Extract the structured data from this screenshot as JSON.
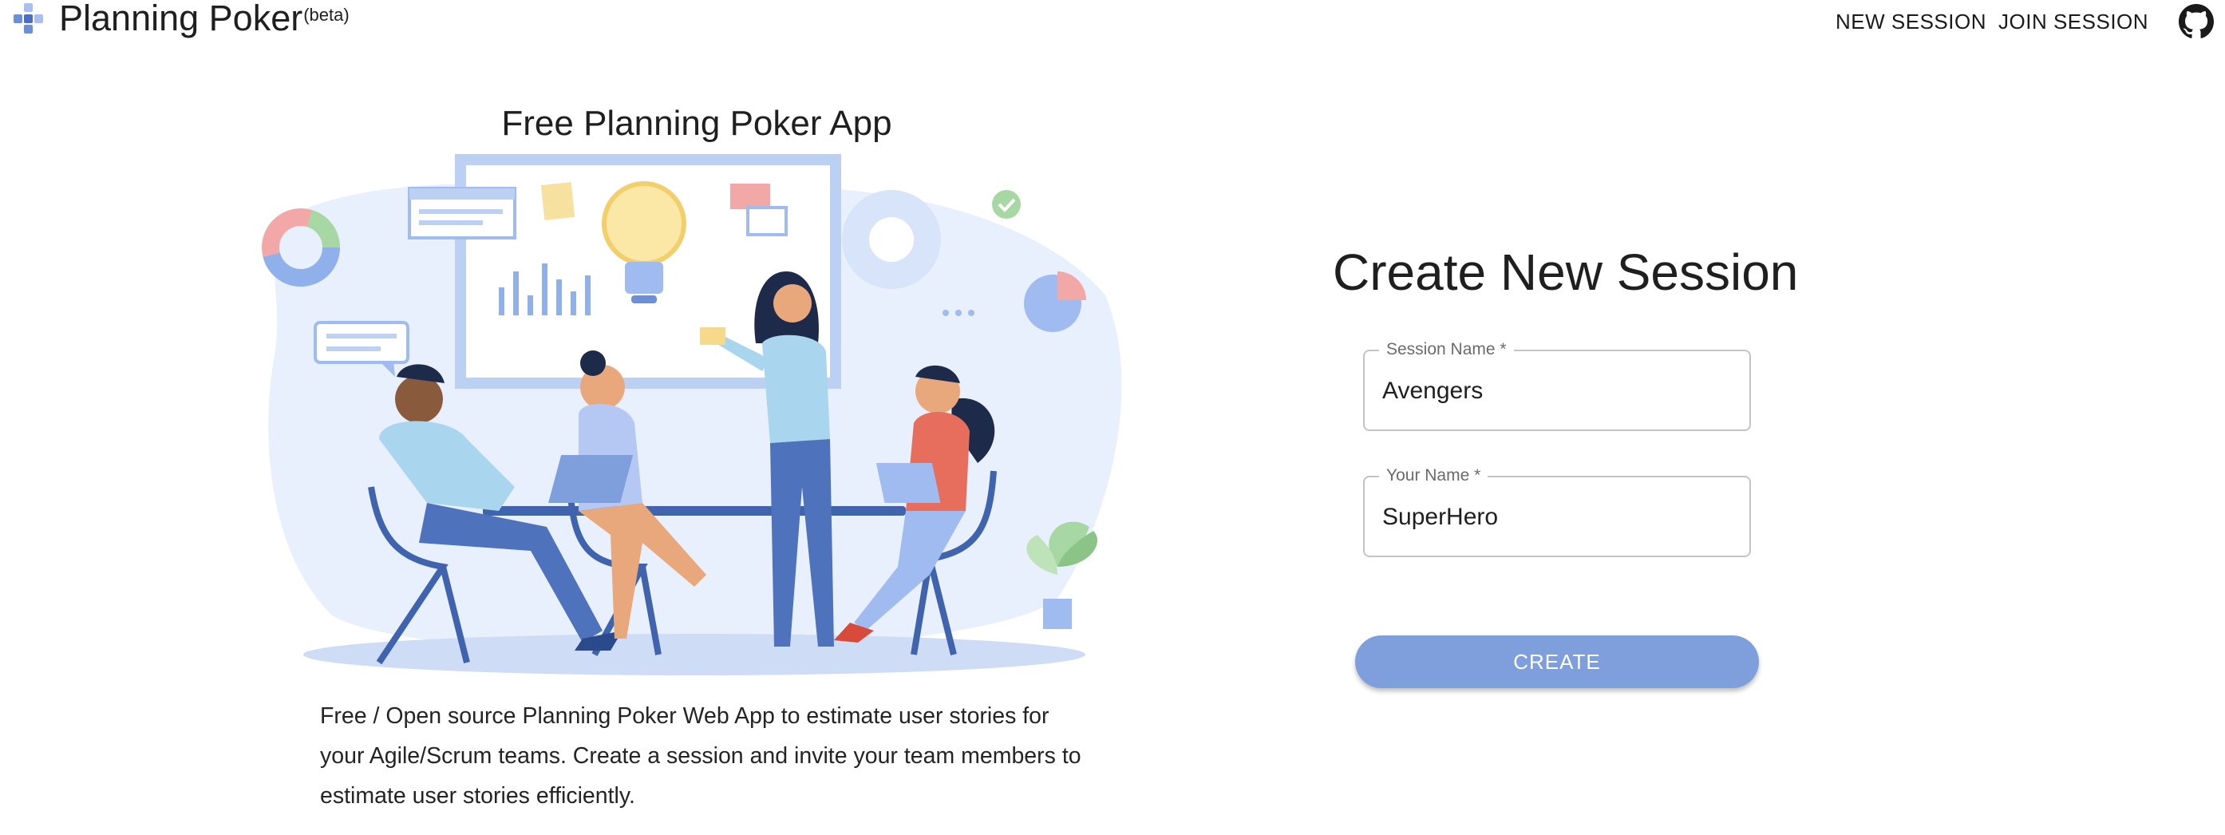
{
  "app": {
    "title": "Planning Poker",
    "badge": "(beta)"
  },
  "nav": {
    "new_session": "NEW SESSION",
    "join_session": "JOIN SESSION",
    "github_icon": "github-icon"
  },
  "hero": {
    "title": "Free Planning Poker App",
    "description": "Free / Open source Planning Poker Web App to estimate user stories for your Agile/Scrum teams. Create a session and invite your team members to estimate user stories efficiently."
  },
  "form": {
    "title": "Create New Session",
    "session_name_label": "Session Name *",
    "session_name_value": "Avengers",
    "your_name_label": "Your Name *",
    "your_name_value": "SuperHero",
    "create_label": "CREATE"
  },
  "colors": {
    "brand_blue": "#6c8fd6",
    "button_blue": "#7f9fdc",
    "illustration_light": "#e8f0fd",
    "illustration_mid": "#9fbbef",
    "illustration_dark": "#3f63ad"
  }
}
